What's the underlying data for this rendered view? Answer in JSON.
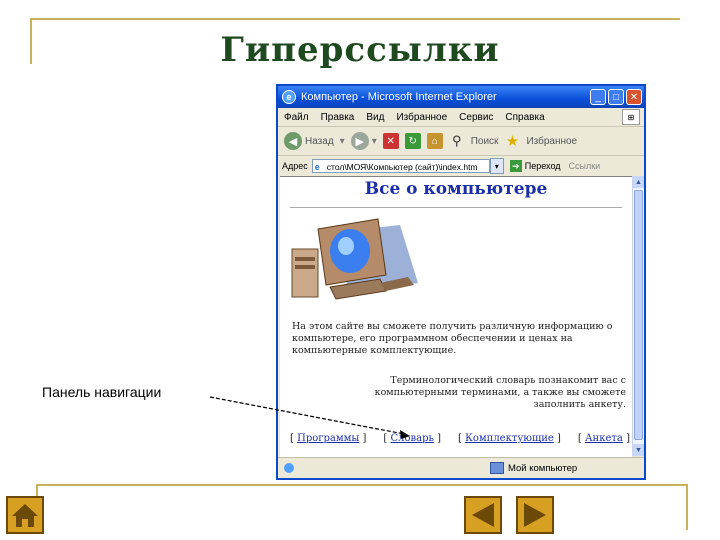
{
  "slide": {
    "title": "Гиперссылки",
    "callout_label": "Панель навигации"
  },
  "browser": {
    "window_title": "Компьютер - Microsoft Internet Explorer",
    "menu": [
      "Файл",
      "Правка",
      "Вид",
      "Избранное",
      "Сервис",
      "Справка"
    ],
    "toolbar": {
      "back_label": "Назад",
      "search_label": "Поиск",
      "favorites_label": "Избранное"
    },
    "address": {
      "label": "Адрес",
      "value": "стол\\МОЯ\\Компьютер (сайт)\\index.htm",
      "go_label": "Переход",
      "links_label": "Ссылки"
    },
    "status": {
      "zone": "Мой компьютер"
    }
  },
  "page": {
    "heading": "Все о компьютере",
    "intro": "На этом сайте вы сможете получить различную информацию о компьютере, его программном обеспечении и ценах на компьютерные комплектующие.",
    "glossary": "Терминологический словарь познакомит вас с компьютерными терминами, а также вы сможете заполнить анкету.",
    "nav_links": [
      "Программы",
      "Словарь",
      "Комплектующие",
      "Анкета"
    ]
  },
  "colors": {
    "frame": "#c9b25a",
    "title": "#1f4a1f",
    "page_heading": "#1d2fa8",
    "nav_button": "#d8a022"
  }
}
